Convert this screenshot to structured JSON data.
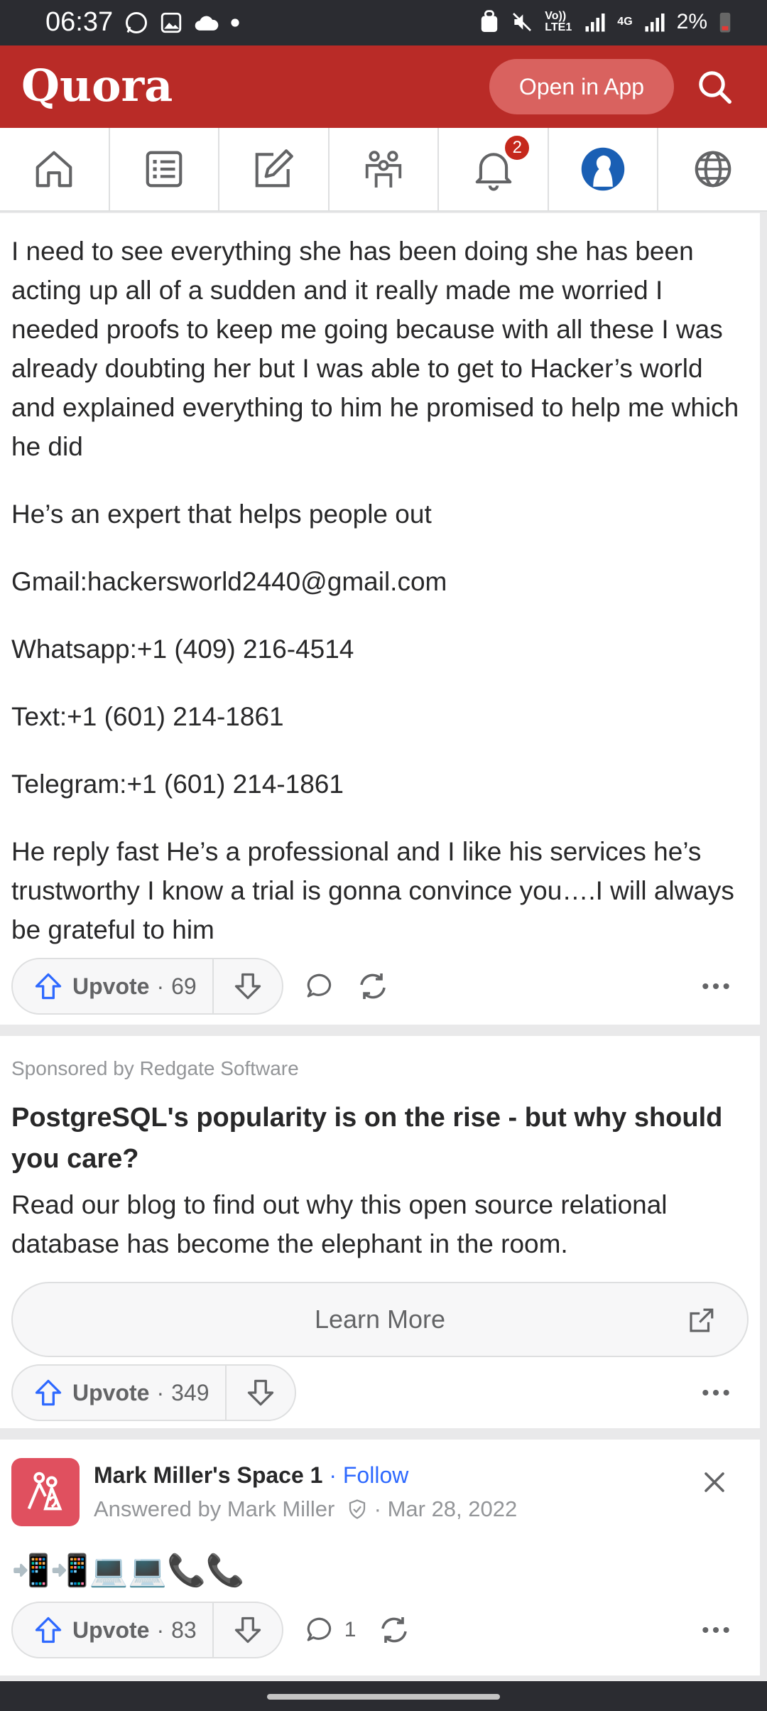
{
  "status": {
    "time": "06:37",
    "battery": "2%",
    "volte": "Vo)) LTE1",
    "network": "4G"
  },
  "header": {
    "logo": "Quora",
    "open_app": "Open in App"
  },
  "nav": {
    "notifications_badge": "2"
  },
  "answer": {
    "paragraphs": [
      "I need to see everything she has been doing she has been acting up all of a sudden and it really made me worried I needed proofs to keep me going because with all these I was already doubting her but I was able to get to Hacker’s world and explained everything to him he promised to help me which he did",
      "He’s an expert that helps people out",
      "Gmail:hackersworld2440@gmail.com",
      "Whatsapp:+1 (409) 216-4514",
      "Text:+1 (601) 214-1861",
      "Telegram:+1 (601) 214-1861",
      "He reply fast He’s a professional and I like his services he’s trustworthy I know a trial is gonna convince you….I will always be grateful to him"
    ],
    "upvote_label": "Upvote",
    "upvotes": "69"
  },
  "ad": {
    "sponsor": "Sponsored by Redgate Software",
    "title": "PostgreSQL's popularity is on the rise - but why should you care?",
    "body": "Read our blog to find out why this open source relational database has become the elephant in the room.",
    "cta": "Learn More",
    "upvote_label": "Upvote",
    "upvotes": "349"
  },
  "post": {
    "space": "Mark Miller's Space 1",
    "follow": "Follow",
    "answered_by": "Answered by Mark Miller",
    "date": "Mar 28, 2022",
    "emoji": "📲📲💻💻📞📞",
    "upvote_label": "Upvote",
    "upvotes": "83",
    "comments": "1"
  },
  "colors": {
    "brand": "#b92b27",
    "link": "#2e69ff",
    "badge": "#c5281c"
  }
}
